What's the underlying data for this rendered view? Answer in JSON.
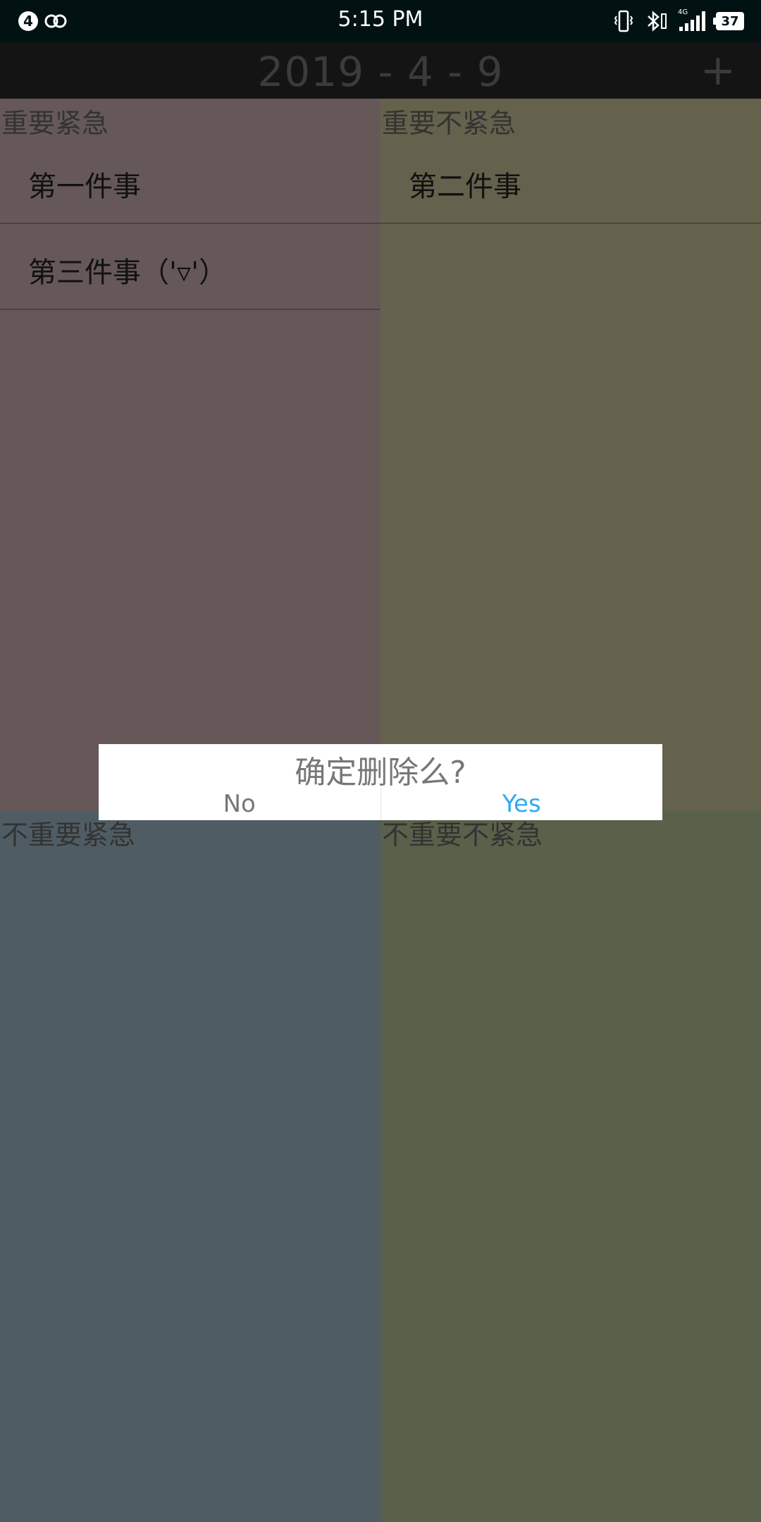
{
  "status_bar": {
    "notification_count": "4",
    "time": "5:15 PM",
    "network_type": "4G",
    "battery_level": "37"
  },
  "app_bar": {
    "date_title": "2019 - 4 - 9",
    "add_label": "+"
  },
  "quadrants": {
    "important_urgent": {
      "title": "重要紧急",
      "tasks": [
        "第一件事",
        "第三件事（'▿'）"
      ]
    },
    "important_not_urgent": {
      "title": "重要不紧急",
      "tasks": [
        "第二件事"
      ]
    },
    "not_important_urgent": {
      "title": "不重要紧急",
      "tasks": []
    },
    "not_important_not_urgent": {
      "title": "不重要不紧急",
      "tasks": []
    }
  },
  "dialog": {
    "title": "确定删除么?",
    "no_label": "No",
    "yes_label": "Yes"
  },
  "colors": {
    "q1_bg": "#665859",
    "q2_bg": "#64624c",
    "q3_bg": "#4f5c63",
    "q4_bg": "#5a614a",
    "accent_yes": "#33a9ef"
  }
}
